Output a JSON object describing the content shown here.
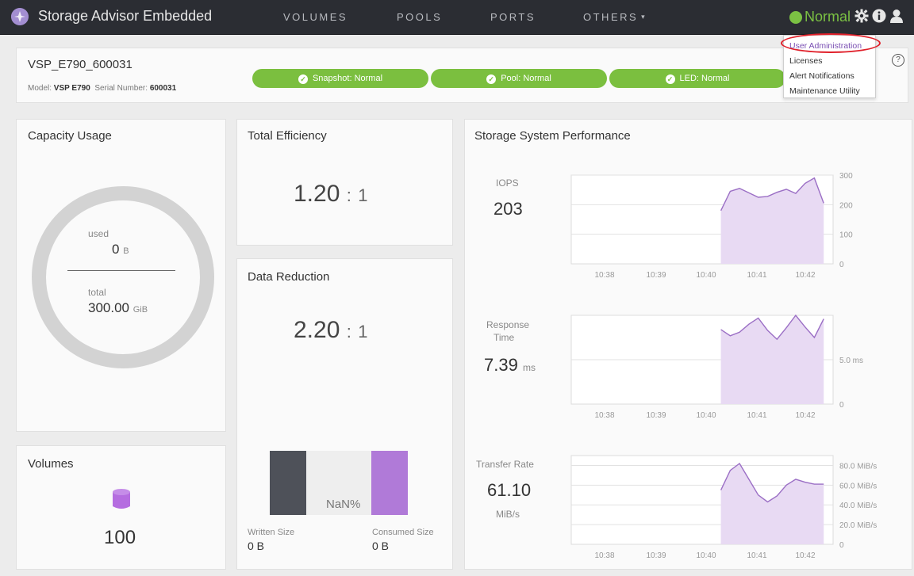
{
  "app": {
    "title": "Storage Advisor Embedded",
    "logo_icon": "hitachi-logo-icon"
  },
  "nav": {
    "items": [
      "VOLUMES",
      "POOLS",
      "PORTS",
      "OTHERS"
    ],
    "others_caret": "▾"
  },
  "status": {
    "label": "Normal",
    "color": "#7bc143"
  },
  "top_icons": {
    "settings": "gear-icon",
    "info": "info-icon",
    "user": "user-icon"
  },
  "dropdown": {
    "items": [
      "User Administration",
      "Licenses",
      "Alert Notifications",
      "Maintenance Utility"
    ],
    "highlighted": "User Administration"
  },
  "system": {
    "name": "VSP_E790_600031",
    "model_label": "Model:",
    "model": "VSP E790",
    "serial_label": "Serial Number:",
    "serial": "600031",
    "badges": [
      "Snapshot: Normal",
      "Pool: Normal",
      "LED: Normal"
    ],
    "badge_color": "#7bbf3f"
  },
  "capacity": {
    "title": "Capacity Usage",
    "used_label": "used",
    "used_value": "0",
    "used_unit": "B",
    "total_label": "total",
    "total_value": "300.00",
    "total_unit": "GiB",
    "used_fraction": 0
  },
  "volumes": {
    "title": "Volumes",
    "count": "100",
    "icon": "database-icon"
  },
  "efficiency": {
    "title": "Total Efficiency",
    "value": "1.20",
    "sep": ":",
    "ratio": "1"
  },
  "reduction": {
    "title": "Data Reduction",
    "value": "2.20",
    "sep": ":",
    "ratio": "1",
    "bar_label": "NaN%",
    "written_label": "Written Size",
    "written_value": "0 B",
    "consumed_label": "Consumed Size",
    "consumed_value": "0 B",
    "colors": {
      "written": "#4e5159",
      "middle": "#eeeeee",
      "consumed": "#b07ad8"
    }
  },
  "performance": {
    "title": "Storage System Performance",
    "iops": {
      "label": "IOPS",
      "value": "203",
      "unit": ""
    },
    "response": {
      "label_line1": "Response",
      "label_line2": "Time",
      "value": "7.39",
      "unit": "ms"
    },
    "transfer": {
      "label": "Transfer Rate",
      "value": "61.10",
      "unit": "MiB/s"
    }
  },
  "chart_data": [
    {
      "type": "area",
      "title": "IOPS",
      "x_ticks": [
        "10:38",
        "10:39",
        "10:40",
        "10:41",
        "10:42"
      ],
      "y_ticks": [
        "300",
        "200",
        "100",
        "0"
      ],
      "ylim": [
        0,
        300
      ],
      "series": [
        {
          "x": [
            10.7,
            10.75,
            10.8,
            10.85,
            10.9,
            10.95,
            11.0,
            11.05,
            11.1,
            11.15,
            11.2,
            11.25
          ],
          "values": [
            180,
            245,
            255,
            240,
            225,
            228,
            242,
            252,
            238,
            272,
            290,
            205
          ]
        }
      ]
    },
    {
      "type": "area",
      "title": "Response Time",
      "x_ticks": [
        "10:38",
        "10:39",
        "10:40",
        "10:41",
        "10:42"
      ],
      "y_ticks": [
        "5.0 ms",
        "0"
      ],
      "ylim": [
        0,
        10
      ],
      "series": [
        {
          "x": [
            10.7,
            10.75,
            10.8,
            10.85,
            10.9,
            10.95,
            11.0,
            11.05,
            11.1,
            11.15,
            11.2,
            11.25
          ],
          "values": [
            8.4,
            7.7,
            8.1,
            9.0,
            9.7,
            8.3,
            7.3,
            8.6,
            10.0,
            8.7,
            7.5,
            9.6
          ]
        }
      ]
    },
    {
      "type": "area",
      "title": "Transfer Rate",
      "x_ticks": [
        "10:38",
        "10:39",
        "10:40",
        "10:41",
        "10:42"
      ],
      "y_ticks": [
        "80.0 MiB/s",
        "60.0 MiB/s",
        "40.0 MiB/s",
        "20.0 MiB/s",
        "0"
      ],
      "ylim": [
        0,
        90
      ],
      "series": [
        {
          "x": [
            10.7,
            10.75,
            10.8,
            10.85,
            10.9,
            10.95,
            11.0,
            11.05,
            11.1,
            11.15,
            11.2,
            11.25
          ],
          "values": [
            55,
            75,
            82,
            66,
            50,
            43,
            49,
            60,
            66,
            63,
            61,
            61
          ]
        }
      ]
    }
  ]
}
